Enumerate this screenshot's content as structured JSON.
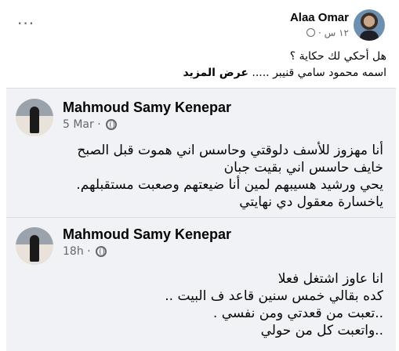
{
  "post": {
    "author": "Alaa Omar",
    "time": "١٢ س ·",
    "text_line1": "هل أحكي لك حكاية ؟",
    "text_line2_prefix": "اسمه محمود سامي قنيبر ..... ",
    "see_more": "عرض المزيد"
  },
  "cards": [
    {
      "author": "Mahmoud Samy Kenepar",
      "time": "5 Mar ·",
      "lines": [
        "أنا مهزوز للأسف دلوقتي وحاسس اني هموت قبل الصبح",
        "خايف  حاسس اني بقيت جبان",
        "يحي ورشيد هسيبهم لمين  أنا ضيعتهم وصعبت مستقبلهم.",
        "ياخسارة  معقول دي نهايتي"
      ]
    },
    {
      "author": "Mahmoud Samy Kenepar",
      "time": "18h ·",
      "lines": [
        "انا عاوز اشتغل فعلا",
        "كده بقالي خمس سنين قاعد ف البيت ..",
        "..تعبت من قعدتي ومن نفسي .",
        "..واتعبت كل من حولي"
      ]
    }
  ]
}
